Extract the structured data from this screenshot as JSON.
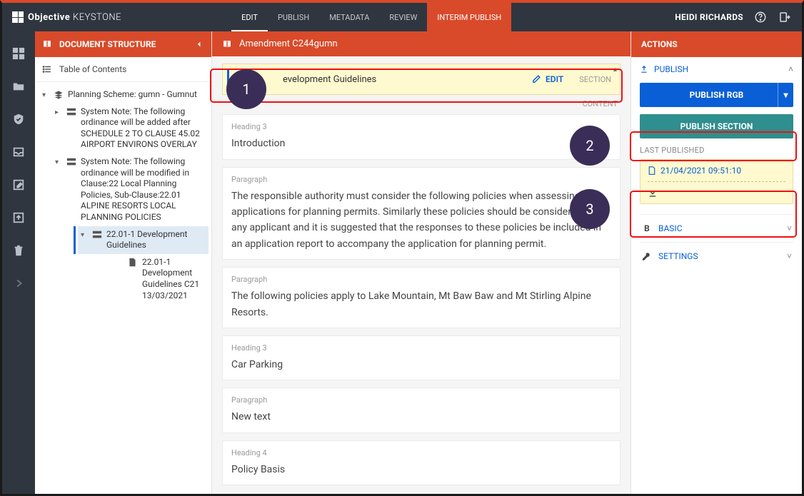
{
  "brand": {
    "name_bold": "Objective",
    "name_light": "KEYSTONE"
  },
  "tabs": [
    "EDIT",
    "PUBLISH",
    "METADATA",
    "REVIEW",
    "INTERIM PUBLISH"
  ],
  "active_tab": "EDIT",
  "interim_tab_index": 4,
  "user": "HEIDI RICHARDS",
  "left_panel": {
    "title": "DOCUMENT STRUCTURE",
    "toc_label": "Table of Contents",
    "root": "Planning Scheme: gumn - Gumnut",
    "node_a": "System Note: The following ordinance will be added after SCHEDULE 2 TO CLAUSE 45.02 AIRPORT ENVIRONS OVERLAY",
    "node_b": "System Note: The following ordinance will be modified in Clause:22 Local Planning Policies, Sub-Clause:22.01 ALPINE RESORTS LOCAL PLANNING POLICIES",
    "node_sel": "22.01-1 Development Guidelines",
    "node_c": "22.01-1 Development Guidelines C21 13/03/2021"
  },
  "center": {
    "breadcrumb_doc": "Amendment C244gumn",
    "section_title": "evelopment Guidelines",
    "edit_label": "EDIT",
    "section_badge": "SECTION",
    "content_label": "CONTENT",
    "blocks": [
      {
        "label": "Heading 3",
        "content": "Introduction"
      },
      {
        "label": "Paragraph",
        "content": "The responsible authority must consider the following policies when assessing applications for planning permits. Similarly these policies should be considered by any applicant and it is suggested that the responses to these policies be included in an application report to accompany the application for planning permit."
      },
      {
        "label": "Paragraph",
        "content": "The following policies apply to Lake Mountain, Mt Baw Baw and Mt Stirling Alpine Resorts."
      },
      {
        "label": "Heading 3",
        "content": "Car Parking"
      },
      {
        "label": "Paragraph",
        "content": "New text"
      },
      {
        "label": "Heading 4",
        "content": "Policy Basis"
      }
    ]
  },
  "right_panel": {
    "title": "ACTIONS",
    "publish_row": "PUBLISH",
    "btn_rgb": "PUBLISH RGB",
    "btn_section": "PUBLISH SECTION",
    "last_published_label": "LAST PUBLISHED",
    "last_published_time": "21/04/2021 09:51:10",
    "basic_row": "BASIC",
    "settings_row": "SETTINGS"
  },
  "callouts": {
    "c1": "1",
    "c2": "2",
    "c3": "3"
  }
}
